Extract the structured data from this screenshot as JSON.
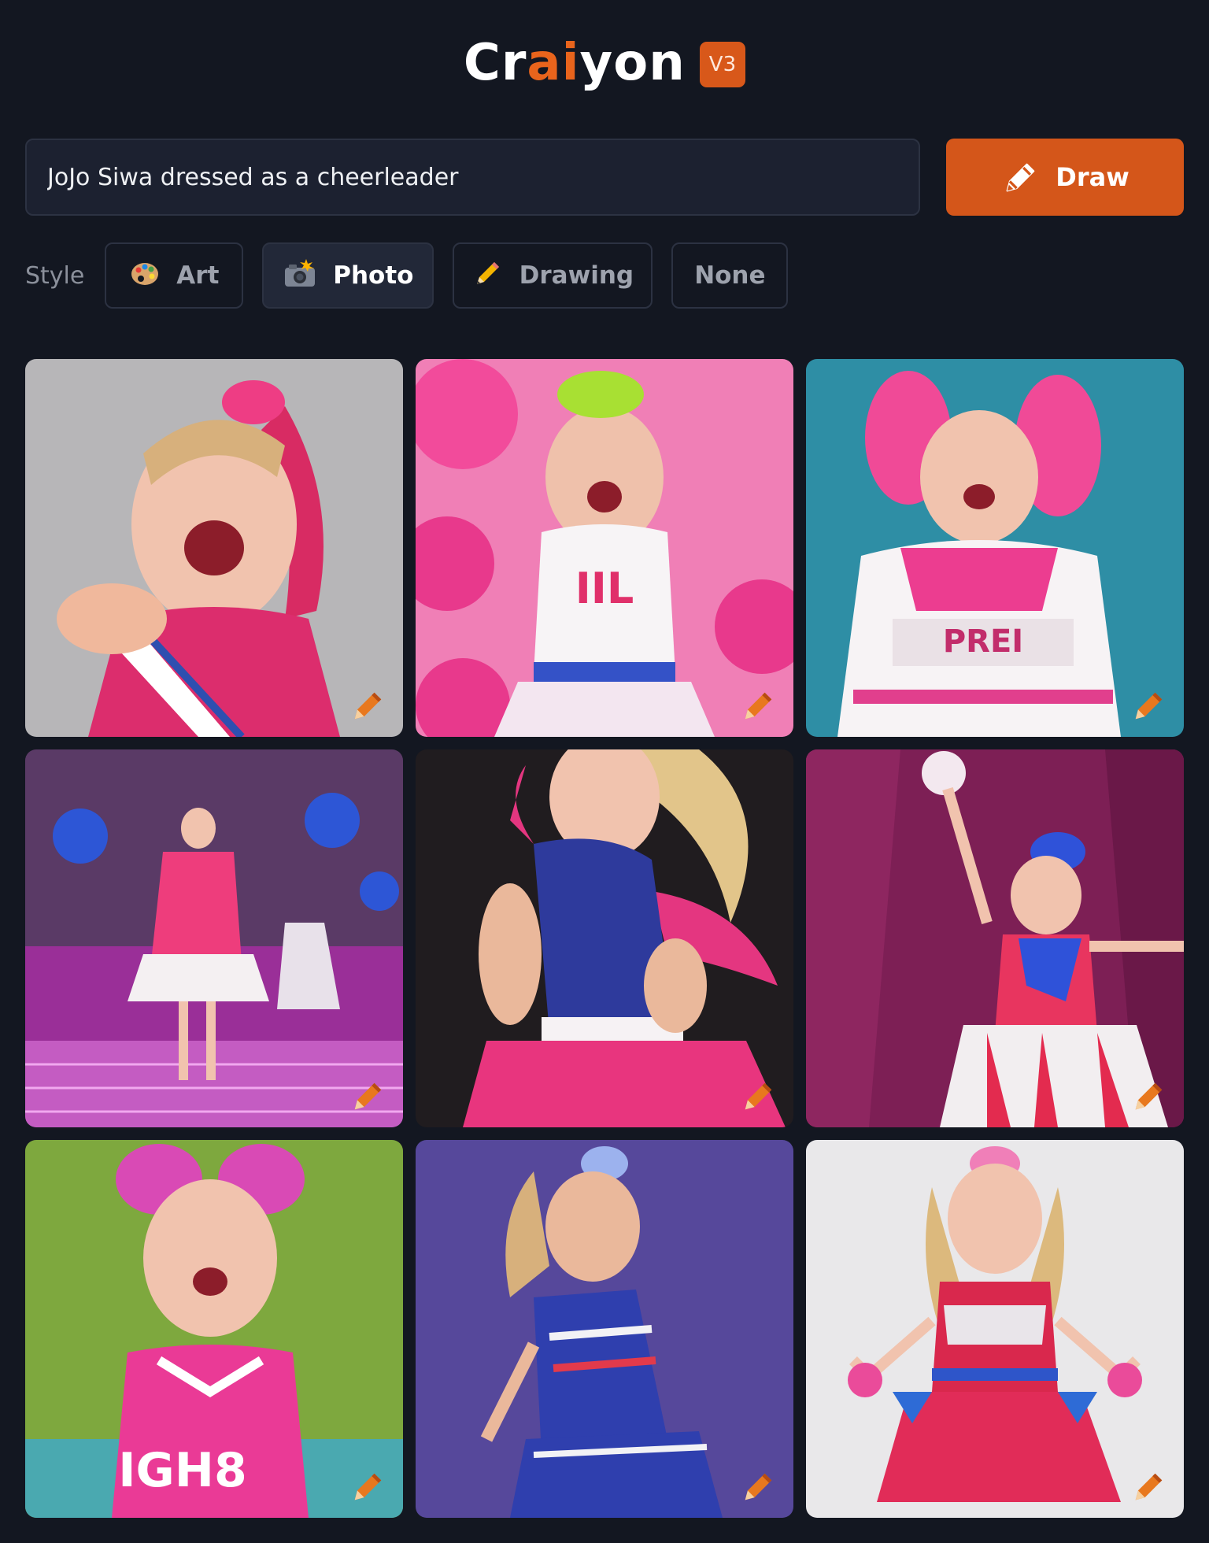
{
  "header": {
    "logo_text_part1": "Cr",
    "logo_text_accent": "ai",
    "logo_text_part2": "yon",
    "version_badge": "V3"
  },
  "prompt": {
    "value": "JoJo Siwa dressed as a cheerleader"
  },
  "draw_button": {
    "label": "Draw",
    "icon": "pencil-icon"
  },
  "style_selector": {
    "label": "Style",
    "options": [
      {
        "label": "Art",
        "icon": "palette-icon",
        "selected": false
      },
      {
        "label": "Photo",
        "icon": "camera-flash-icon",
        "selected": true
      },
      {
        "label": "Drawing",
        "icon": "pencil-icon",
        "selected": false
      },
      {
        "label": "None",
        "icon": "",
        "selected": false
      }
    ]
  },
  "results": {
    "image_count": 9
  },
  "colors": {
    "background": "#131721",
    "accent": "#d4561a",
    "input_background": "#1c2130",
    "border": "#2c3242"
  }
}
